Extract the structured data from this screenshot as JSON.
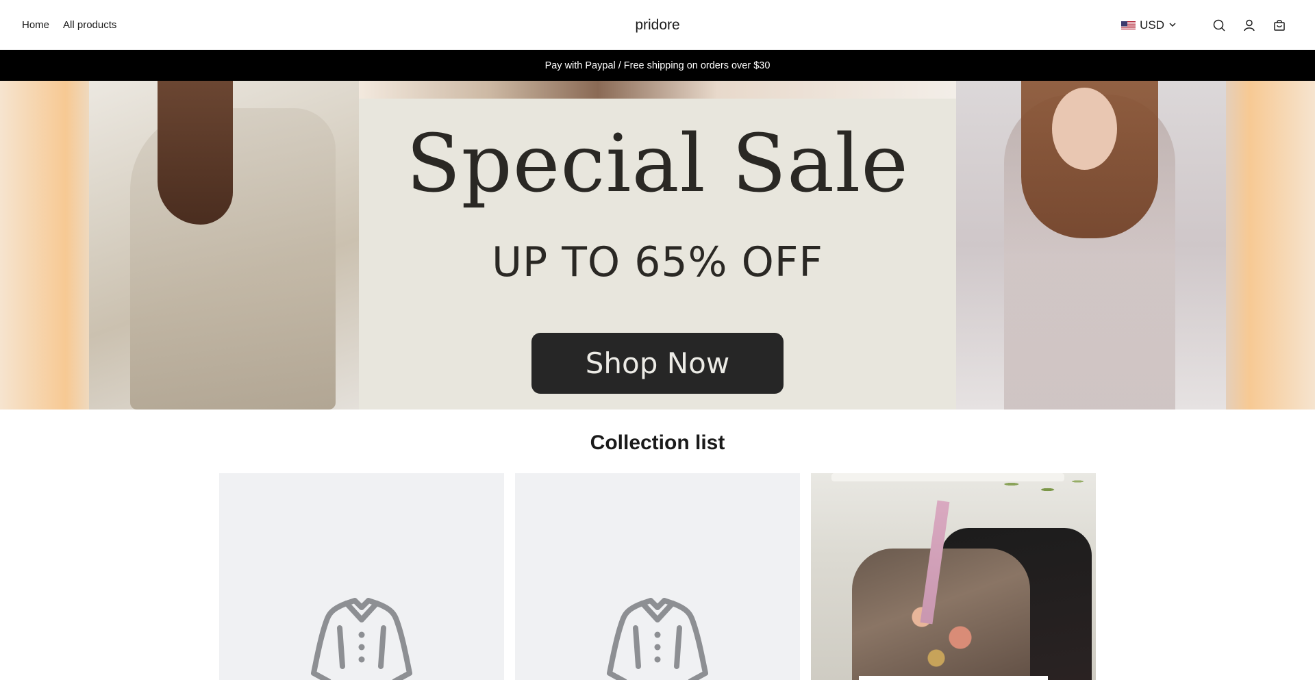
{
  "header": {
    "nav": [
      {
        "label": "Home"
      },
      {
        "label": "All products"
      }
    ],
    "brand": "pridore",
    "currency": {
      "code": "USD",
      "flag": "us-flag-icon"
    },
    "icons": [
      "search-icon",
      "account-icon",
      "cart-icon"
    ]
  },
  "announcement": {
    "text": "Pay with Paypal / Free shipping on orders over $30"
  },
  "hero": {
    "title": "Special Sale",
    "subtitle": "UP TO 65% OFF",
    "button_label": "Shop Now"
  },
  "collection": {
    "title": "Collection list",
    "cards": [
      {
        "kind": "placeholder",
        "icon": "shirt-icon"
      },
      {
        "kind": "placeholder",
        "icon": "shirt-icon"
      },
      {
        "kind": "image",
        "description_icon": "embroidered-jacket-image"
      }
    ]
  },
  "colors": {
    "announcement_bg": "#000000",
    "hero_panel": "#e8e6dd",
    "button_bg": "#262626",
    "placeholder_bg": "#f0f1f3"
  }
}
